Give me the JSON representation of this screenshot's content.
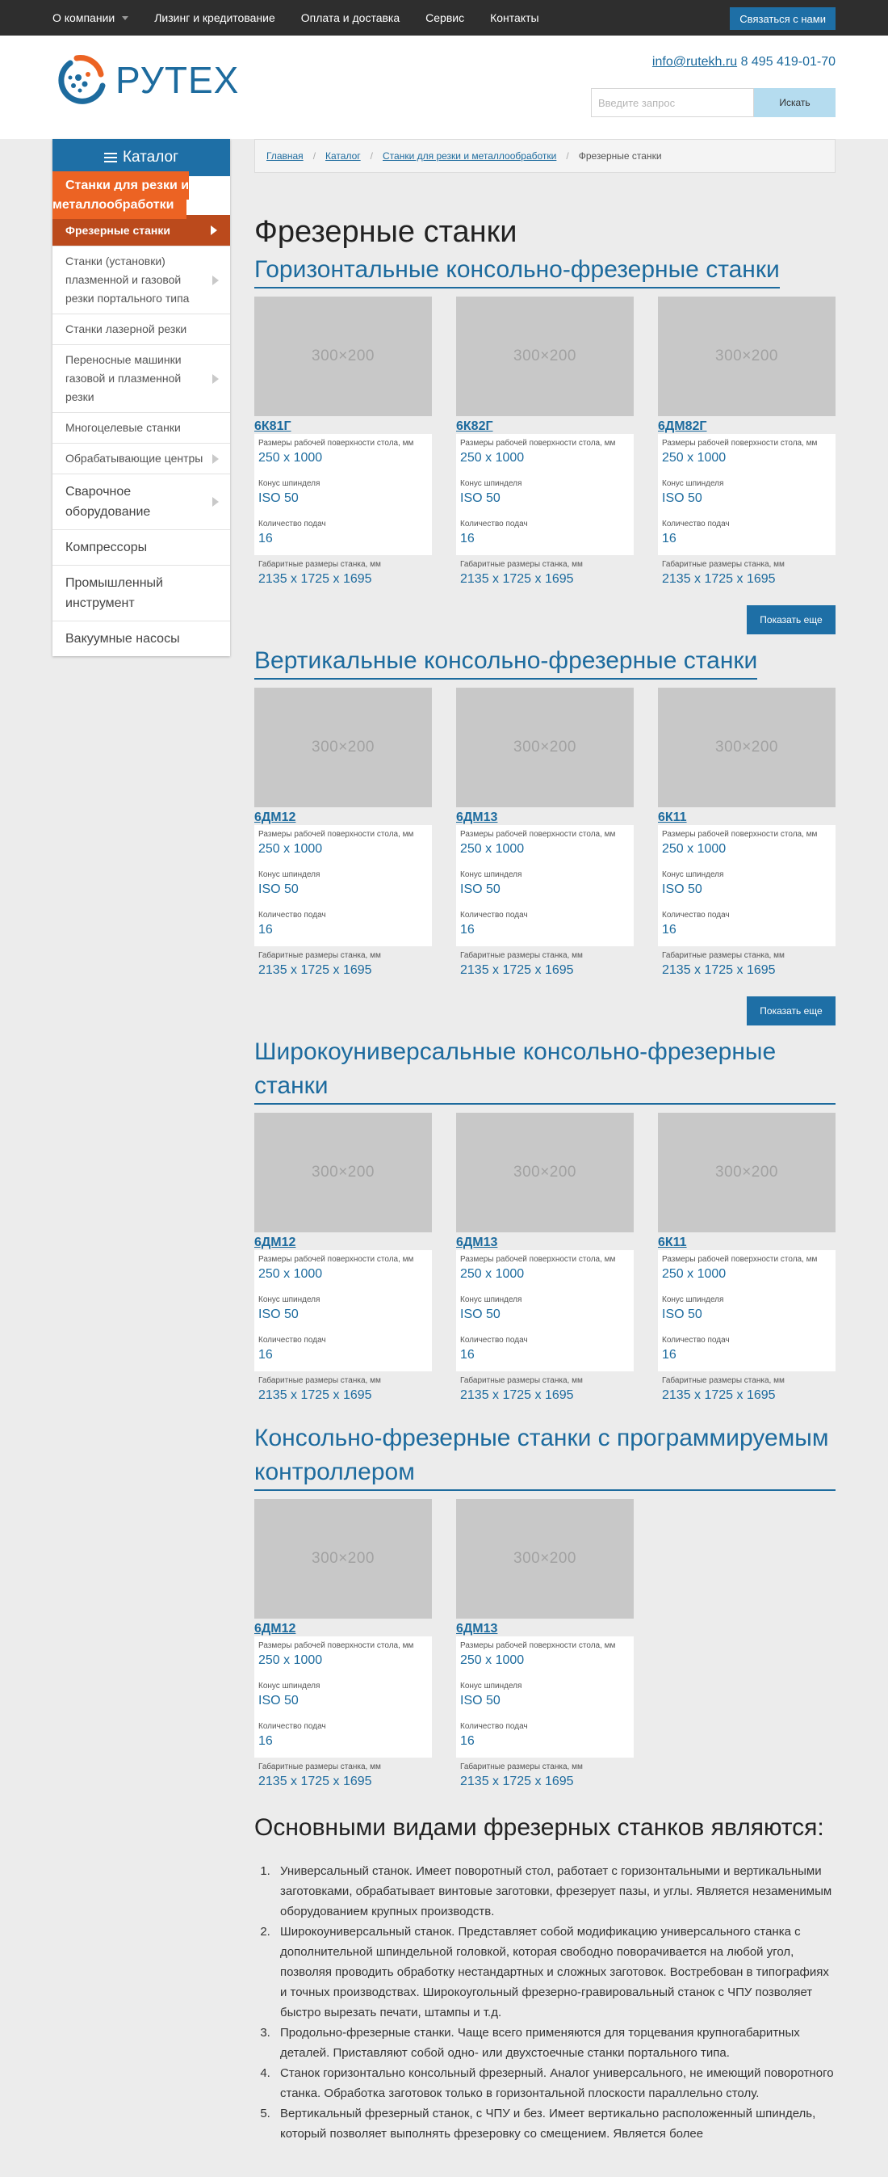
{
  "topnav": {
    "items": [
      "О компании",
      "Лизинг и кредитование",
      "Оплата и доставка",
      "Сервис",
      "Контакты"
    ],
    "contact_button": "Связаться с нами"
  },
  "header": {
    "logo_text": "РУТЕХ",
    "email": "info@rutekh.ru",
    "phone": "8 495 419-01-70",
    "search_placeholder": "Введите запрос",
    "search_button": "Искать"
  },
  "sidebar": {
    "title": "Каталог",
    "category": "Станки для резки и металлообработки",
    "active": "Фрезерные станки",
    "items": [
      {
        "label": "Станки (установки) плазменной и газовой резки портального типа",
        "arrow": true,
        "big": false
      },
      {
        "label": "Станки лазерной резки",
        "arrow": false,
        "big": false
      },
      {
        "label": "Переносные машинки газовой и плазменной резки",
        "arrow": true,
        "big": false
      },
      {
        "label": "Многоцелевые станки",
        "arrow": false,
        "big": false
      },
      {
        "label": "Обрабатывающие центры",
        "arrow": true,
        "big": false
      },
      {
        "label": "Сварочное оборудование",
        "arrow": true,
        "big": true
      },
      {
        "label": "Компрессоры",
        "arrow": false,
        "big": true
      },
      {
        "label": "Промышленный инструмент",
        "arrow": false,
        "big": true
      },
      {
        "label": "Вакуумные насосы",
        "arrow": false,
        "big": true
      }
    ]
  },
  "breadcrumb": [
    "Главная",
    "Каталог",
    "Станки для резки и металлообработки",
    "Фрезерные станки"
  ],
  "page_title": "Фрезерные станки",
  "spec_labels": {
    "surface": "Размеры рабочей поверхности стола, мм",
    "cone": "Конус шпинделя",
    "feeds": "Количество подач",
    "dims": "Габаритные размеры станка, мм"
  },
  "placeholder_text": "300×200",
  "more_button": "Показать еще",
  "sections": [
    {
      "title": "Горизонтальные консольно-фрезерные станки",
      "show_more": true,
      "products": [
        {
          "name": "6К81Г",
          "surface": "250 x 1000",
          "cone": "ISO 50",
          "feeds": "16",
          "dims": "2135 x 1725 x 1695"
        },
        {
          "name": "6К82Г",
          "surface": "250 x 1000",
          "cone": "ISO 50",
          "feeds": "16",
          "dims": "2135 x 1725 x 1695"
        },
        {
          "name": "6ДМ82Г",
          "surface": "250 x 1000",
          "cone": "ISO 50",
          "feeds": "16",
          "dims": "2135 x 1725 x 1695"
        }
      ]
    },
    {
      "title": "Вертикальные консольно-фрезерные станки",
      "show_more": true,
      "products": [
        {
          "name": "6ДМ12",
          "surface": "250 x 1000",
          "cone": "ISO 50",
          "feeds": "16",
          "dims": "2135 x 1725 x 1695"
        },
        {
          "name": "6ДМ13",
          "surface": "250 x 1000",
          "cone": "ISO 50",
          "feeds": "16",
          "dims": "2135 x 1725 x 1695"
        },
        {
          "name": "6К11",
          "surface": "250 x 1000",
          "cone": "ISO 50",
          "feeds": "16",
          "dims": "2135 x 1725 x 1695"
        }
      ]
    },
    {
      "title": "Широкоуниверсальные консольно-фрезерные станки",
      "show_more": false,
      "products": [
        {
          "name": "6ДМ12",
          "surface": "250 x 1000",
          "cone": "ISO 50",
          "feeds": "16",
          "dims": "2135 x 1725 x 1695"
        },
        {
          "name": "6ДМ13",
          "surface": "250 x 1000",
          "cone": "ISO 50",
          "feeds": "16",
          "dims": "2135 x 1725 x 1695"
        },
        {
          "name": "6К11",
          "surface": "250 x 1000",
          "cone": "ISO 50",
          "feeds": "16",
          "dims": "2135 x 1725 x 1695"
        }
      ]
    },
    {
      "title": "Консольно-фрезерные станки с программируемым контроллером",
      "show_more": false,
      "products": [
        {
          "name": "6ДМ12",
          "surface": "250 x 1000",
          "cone": "ISO 50",
          "feeds": "16",
          "dims": "2135 x 1725 x 1695"
        },
        {
          "name": "6ДМ13",
          "surface": "250 x 1000",
          "cone": "ISO 50",
          "feeds": "16",
          "dims": "2135 x 1725 x 1695"
        }
      ]
    }
  ],
  "article": {
    "title": "Основными видами фрезерных станков являются:",
    "items": [
      "Универсальный станок. Имеет поворотный стол, работает с горизонтальными и вертикальными заготовками, обрабатывает винтовые заготовки, фрезерует пазы, и углы. Является незаменимым оборудованием крупных производств.",
      "Широкоуниверсальный станок. Представляет собой модификацию универсального станка с дополнительной шпиндельной головкой, которая свободно поворачивается на любой угол, позволяя проводить обработку нестандартных и сложных заготовок. Востребован в типографиях и точных производствах. Широкоугольный фрезерно-гравировальный станок с ЧПУ позволяет быстро вырезать печати, штампы и т.д.",
      "Продольно-фрезерные станки. Чаще всего применяются для торцевания крупногабаритных деталей. Приставляют собой одно- или двухстоечные станки портального типа.",
      "Станок горизонтально консольный фрезерный. Аналог универсального, не имеющий поворотного станка. Обработка заготовок только в горизонтальной плоскости параллельно столу.",
      "Вертикальный фрезерный станок, с ЧПУ и без. Имеет вертикально расположенный шпиндель, который позволяет выполнять фрезеровку со смещением. Является более"
    ]
  }
}
